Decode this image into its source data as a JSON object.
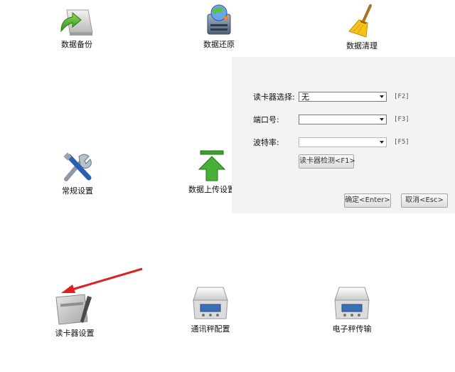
{
  "tiles": {
    "backup": "数据备份",
    "restore": "数据还原",
    "cleanup": "数据清理",
    "general_settings": "常规设置",
    "upload_settings": "数据上传设置",
    "card_reader_settings": "读卡器设置",
    "scale_config": "通讯秤配置",
    "e_scale_transfer": "电子秤传输"
  },
  "dialog": {
    "reader_label": "读卡器选择:",
    "reader_value": "无",
    "reader_hotkey": "[F2]",
    "port_label": "端口号:",
    "port_value": "",
    "port_hotkey": "[F3]",
    "baud_label": "波特率:",
    "baud_value": "",
    "baud_hotkey": "[F5]",
    "detect_button": "读卡器检测<F1>",
    "ok_button": "确定<Enter>",
    "cancel_button": "取消<Esc>"
  },
  "colors": {
    "arrow_red": "#e0201f",
    "dialog_bg": "#f3f3f3",
    "upload_green": "#3aa12a"
  }
}
